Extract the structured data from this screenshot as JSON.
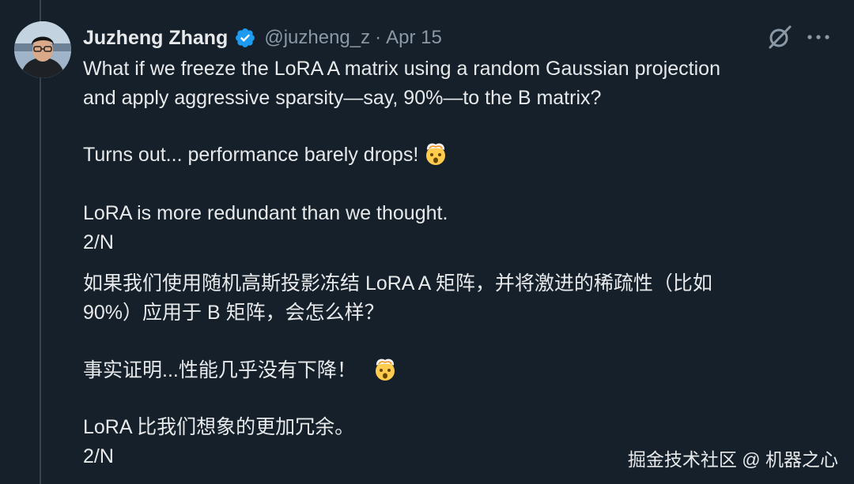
{
  "tweet": {
    "author": {
      "display_name": "Juzheng Zhang",
      "handle": "@juzheng_z",
      "verified": true
    },
    "separator": "·",
    "date": "Apr 15",
    "english": {
      "line1": "What if we freeze the LoRA A matrix using a random Gaussian projection",
      "line2": "and apply aggressive sparsity—say, 90%—to the B matrix?",
      "line3": "Turns out... performance barely drops!",
      "line4": "LoRA is more redundant than we thought.",
      "line5": "2/N"
    },
    "chinese": {
      "line1": "如果我们使用随机高斯投影冻结 LoRA A 矩阵，并将激进的稀疏性（比如",
      "line2": "90%）应用于 B 矩阵，会怎么样？",
      "line3": "事实证明...性能几乎没有下降！",
      "line4": "LoRA 比我们想象的更加冗余。",
      "line5": "2/N"
    },
    "emoji_name": "exploding-head-emoji"
  },
  "actions": {
    "grok_icon": "grok-icon",
    "more_icon": "more-dots-icon"
  },
  "watermark": "掘金技术社区 @ 机器之心",
  "colors": {
    "background": "#15202b",
    "text": "#e7e9ea",
    "secondary_text": "#8b98a5",
    "verified_blue": "#1d9bf0",
    "thread_line": "#38444d"
  }
}
